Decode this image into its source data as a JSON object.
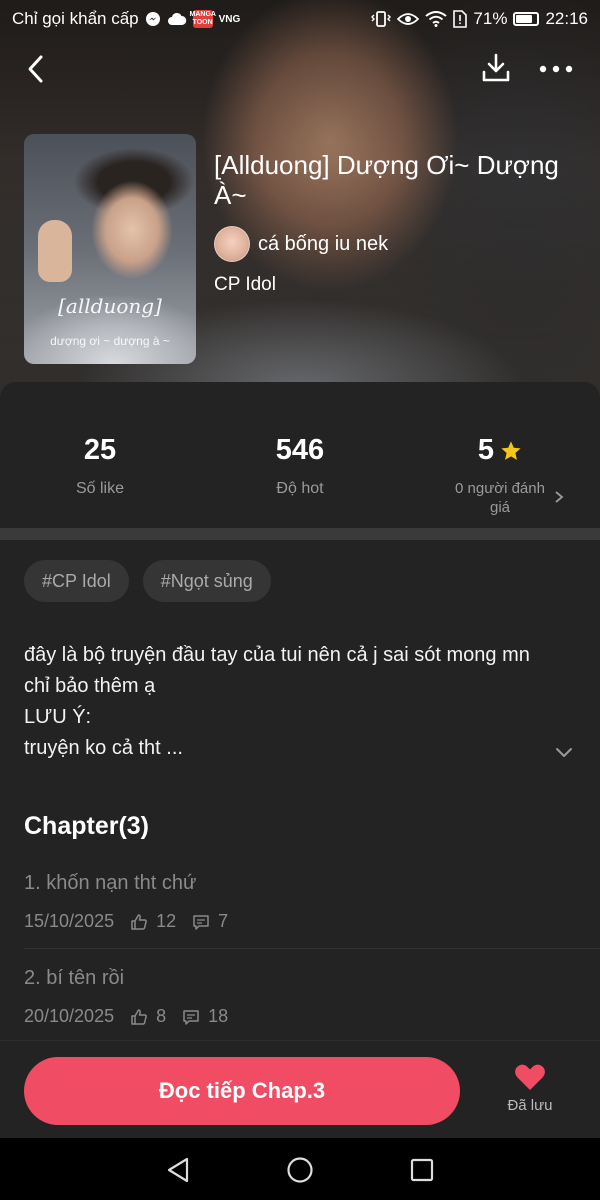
{
  "status_bar": {
    "carrier_text": "Chỉ gọi khẩn cấp",
    "manga_badge": "MANGA TOON",
    "vng_label": "VNG",
    "battery_text": "71%",
    "battery_level": 0.71,
    "time": "22:16"
  },
  "story": {
    "title": "[Allduong] Dượng Ơi~ Dượng À~",
    "author": "cá bống iu nek",
    "category": "CP Idol",
    "cover_title": "[allduong]",
    "cover_subtitle": "dượng ơi ~ dượng à ~"
  },
  "stats": {
    "likes_value": "25",
    "likes_label": "Số like",
    "hot_value": "546",
    "hot_label": "Độ hot",
    "rating_value": "5",
    "rating_label": "0 người đánh giá"
  },
  "tags": [
    "#CP Idol",
    "#Ngọt sủng"
  ],
  "description": "đây là bộ truyện đầu tay của tui nên cả j sai sót mong mn chỉ bảo thêm ạ\nLƯU Ý:\ntruyện ko cả tht ...",
  "chapters_heading": "Chapter(3)",
  "chapters": [
    {
      "title": "1. khốn nạn tht chứ",
      "date": "15/10/2025",
      "likes": "12",
      "comments": "7"
    },
    {
      "title": "2. bí tên rồi",
      "date": "20/10/2025",
      "likes": "8",
      "comments": "18"
    }
  ],
  "actions": {
    "read_label": "Đọc tiếp Chap.3",
    "saved_label": "Đã lưu"
  },
  "colors": {
    "accent": "#f04d65",
    "star": "#f5c518",
    "panel": "#232323"
  }
}
